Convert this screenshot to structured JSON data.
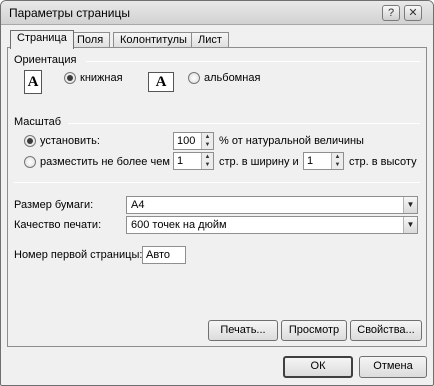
{
  "window": {
    "title": "Параметры страницы",
    "help_button": "?",
    "close_button": "✕"
  },
  "tabs": [
    {
      "label": "Страница",
      "active": true
    },
    {
      "label": "Поля",
      "active": false
    },
    {
      "label": "Колонтитулы",
      "active": false
    },
    {
      "label": "Лист",
      "active": false
    }
  ],
  "orientation": {
    "heading": "Ориентация",
    "portrait_label": "книжная",
    "landscape_label": "альбомная",
    "selected": "portrait",
    "icon_glyph": "A"
  },
  "scale": {
    "heading": "Масштаб",
    "adjust_label": "установить:",
    "adjust_value": "100",
    "adjust_suffix": "% от натуральной величины",
    "fit_label": "разместить не более чем на:",
    "fit_wide_value": "1",
    "fit_wide_suffix": "стр. в ширину и",
    "fit_tall_value": "1",
    "fit_tall_suffix": "стр. в высоту",
    "selected": "adjust"
  },
  "paper_size": {
    "label": "Размер бумаги:",
    "value": "A4"
  },
  "print_quality": {
    "label": "Качество печати:",
    "value": "600 точек на дюйм"
  },
  "first_page": {
    "label": "Номер первой страницы:",
    "value": "Авто"
  },
  "buttons": {
    "print": "Печать...",
    "preview": "Просмотр",
    "options": "Свойства...",
    "ok": "ОК",
    "cancel": "Отмена"
  }
}
